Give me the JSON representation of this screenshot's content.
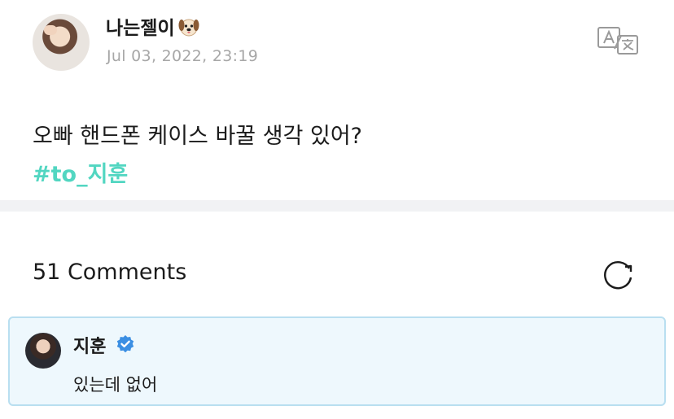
{
  "post": {
    "username": "나는젤이",
    "username_emoji": "🐶",
    "timestamp": "Jul 03, 2022, 23:19",
    "text": "오빠 핸드폰 케이스 바꿀 생각 있어?",
    "hashtag": "#to_지훈",
    "icons": {
      "translate": "translate-icon",
      "emoji": "dog-face-emoji"
    }
  },
  "comments": {
    "count_label": "51 Comments",
    "refresh_icon": "refresh-icon",
    "items": [
      {
        "author": "지훈",
        "verified": true,
        "text": "있는데 없어"
      }
    ]
  },
  "colors": {
    "hashtag": "#52d6c1",
    "timestamp": "#a7a7a7",
    "card_bg": "#eef8fd",
    "card_border": "#b9dff0",
    "verified": "#3b8fe3",
    "divider": "#f1f2f4"
  }
}
